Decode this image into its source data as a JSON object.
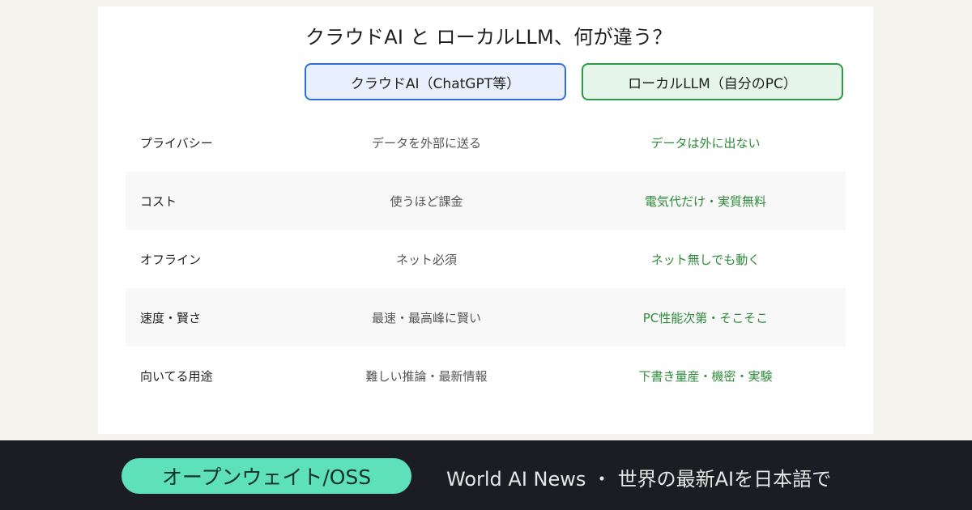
{
  "title": "クラウドAI と ローカルLLM、何が違う？",
  "columns": {
    "cloud": "クラウドAI（ChatGPT等）",
    "local": "ローカルLLM（自分のPC）"
  },
  "rows": [
    {
      "label": "プライバシー",
      "cloud": "データを外部に送る",
      "local": "データは外に出ない"
    },
    {
      "label": "コスト",
      "cloud": "使うほど課金",
      "local": "電気代だけ・実質無料"
    },
    {
      "label": "オフライン",
      "cloud": "ネット必須",
      "local": "ネット無しでも動く"
    },
    {
      "label": "速度・賢さ",
      "cloud": "最速・最高峰に賢い",
      "local": "PC性能次第・そこそこ"
    },
    {
      "label": "向いてる用途",
      "cloud": "難しい推論・最新情報",
      "local": "下書き量産・機密・実験"
    }
  ],
  "footer": {
    "tag": "オープンウェイト/OSS",
    "brand": "World AI News ・ 世界の最新AIを日本語で"
  },
  "colors": {
    "cloud_accent": "#2f6fd9",
    "local_accent": "#2e9a48",
    "tag_bg": "#5ee0b8",
    "footer_bg": "#1c1d22"
  }
}
